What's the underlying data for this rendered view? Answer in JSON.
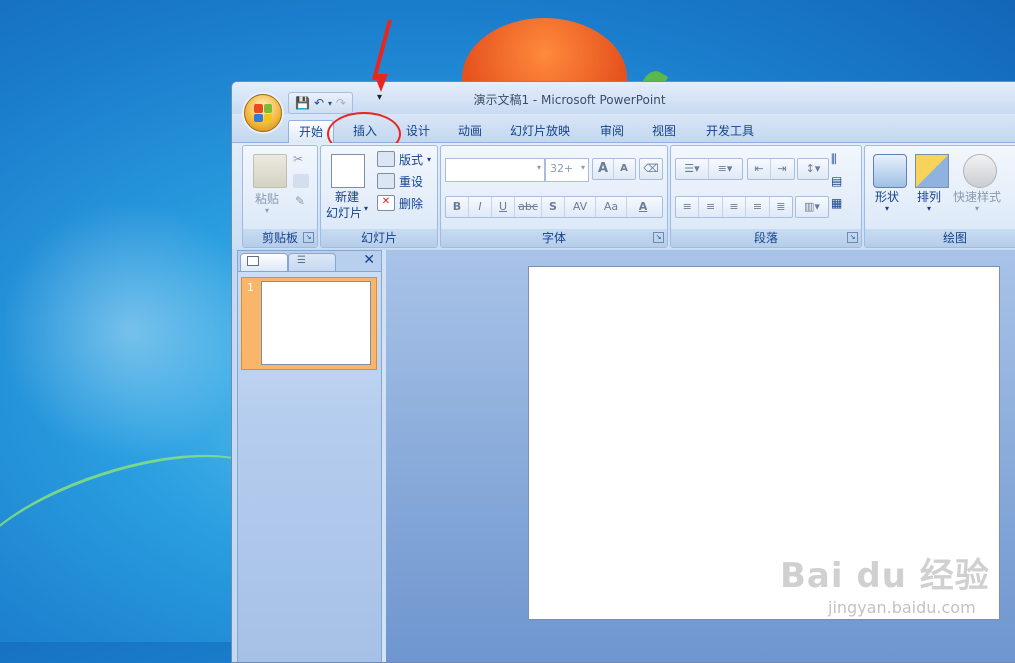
{
  "window": {
    "title": "演示文稿1 - Microsoft PowerPoint"
  },
  "tabs": [
    {
      "label": "开始",
      "active": true
    },
    {
      "label": "插入",
      "active": false,
      "highlighted": true
    },
    {
      "label": "设计",
      "active": false
    },
    {
      "label": "动画",
      "active": false
    },
    {
      "label": "幻灯片放映",
      "active": false
    },
    {
      "label": "审阅",
      "active": false
    },
    {
      "label": "视图",
      "active": false
    },
    {
      "label": "开发工具",
      "active": false
    }
  ],
  "ribbon": {
    "clipboard": {
      "group_label": "剪贴板",
      "paste_label": "粘贴"
    },
    "slides": {
      "group_label": "幻灯片",
      "new_slide_line1": "新建",
      "new_slide_line2": "幻灯片",
      "layout_label": "版式",
      "reset_label": "重设",
      "delete_label": "删除"
    },
    "font": {
      "group_label": "字体",
      "font_name": "",
      "font_size": "32+",
      "grow": "A",
      "shrink": "A",
      "bold": "B",
      "italic": "I",
      "underline": "U",
      "strike": "abc",
      "shadow": "S",
      "spacing": "AV",
      "case": "Aa",
      "color": "A"
    },
    "paragraph": {
      "group_label": "段落"
    },
    "drawing": {
      "group_label": "绘图",
      "shapes_label": "形状",
      "arrange_label": "排列",
      "quick_styles_label": "快速样式"
    }
  },
  "slides_pane": {
    "slide_number": "1",
    "close_glyph": "✕"
  },
  "watermark": {
    "brand": "Bai du 经验",
    "url": "jingyan.baidu.com"
  },
  "colors": {
    "annotation_red": "#e8261e",
    "ribbon_text": "#15428b",
    "selected_slide": "#f9b56a"
  }
}
